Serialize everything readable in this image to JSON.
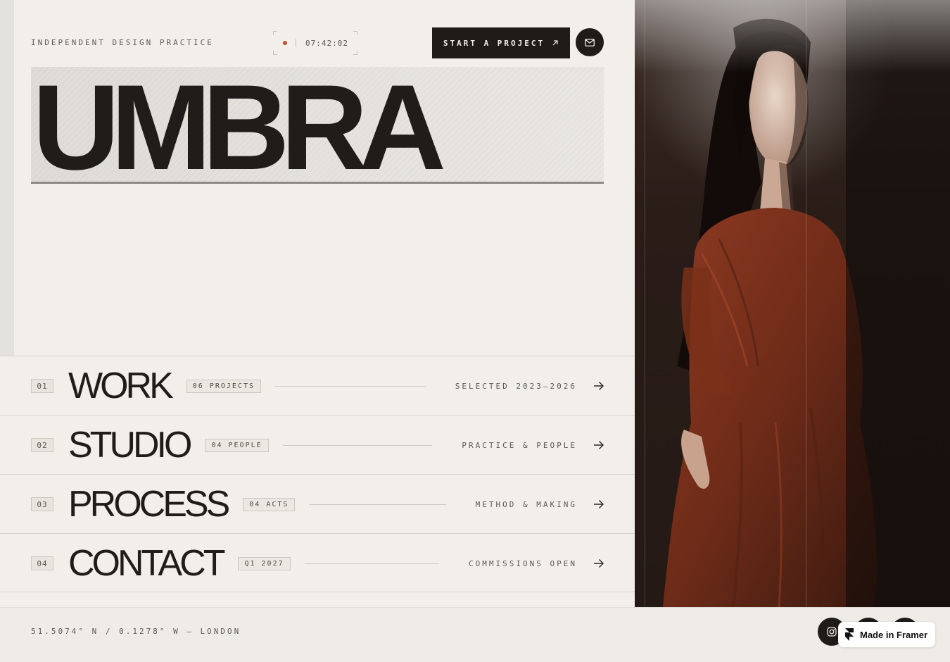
{
  "header": {
    "tagline": "INDEPENDENT DESIGN PRACTICE",
    "clock": "07:42:02",
    "cta_label": "START A PROJECT",
    "cta_icon": "arrow-up-right-icon",
    "mail_icon": "mail-icon"
  },
  "hero": {
    "title": "UMBRA"
  },
  "nav": [
    {
      "num": "01",
      "title": "WORK",
      "badge": "06 PROJECTS",
      "desc": "SELECTED 2023–2026"
    },
    {
      "num": "02",
      "title": "STUDIO",
      "badge": "04 PEOPLE",
      "desc": "PRACTICE & PEOPLE"
    },
    {
      "num": "03",
      "title": "PROCESS",
      "badge": "04 ACTS",
      "desc": "METHOD & MAKING"
    },
    {
      "num": "04",
      "title": "CONTACT",
      "badge": "Q1 2027",
      "desc": "COMMISSIONS OPEN"
    }
  ],
  "footer": {
    "coords": "51.5074° N / 0.1278° W — LONDON",
    "framer_label": "Made in Framer"
  },
  "colors": {
    "accent": "#c4512d",
    "ink": "#1f1b18",
    "paper": "#f2efea"
  }
}
